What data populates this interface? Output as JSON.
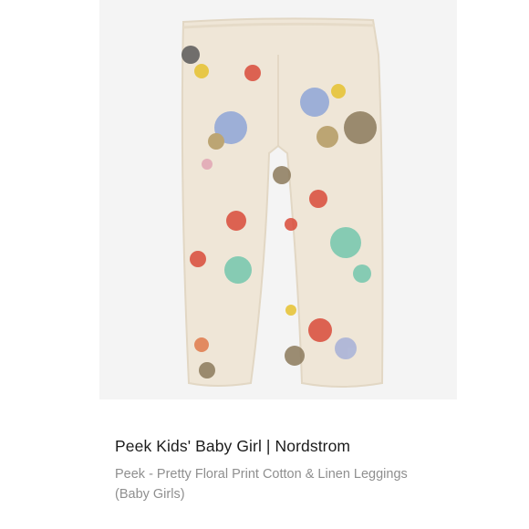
{
  "product": {
    "image_label": "",
    "title": "Peek Kids' Baby Girl | Nordstrom",
    "description": "Peek - Pretty Floral Print Cotton & Linen Leggings (Baby Girls)"
  },
  "colors": {
    "panel_background": "#f4f4f4",
    "fabric": "#efe6d7",
    "title_text": "#1c1c1c",
    "description_text": "#8f8f8f"
  }
}
